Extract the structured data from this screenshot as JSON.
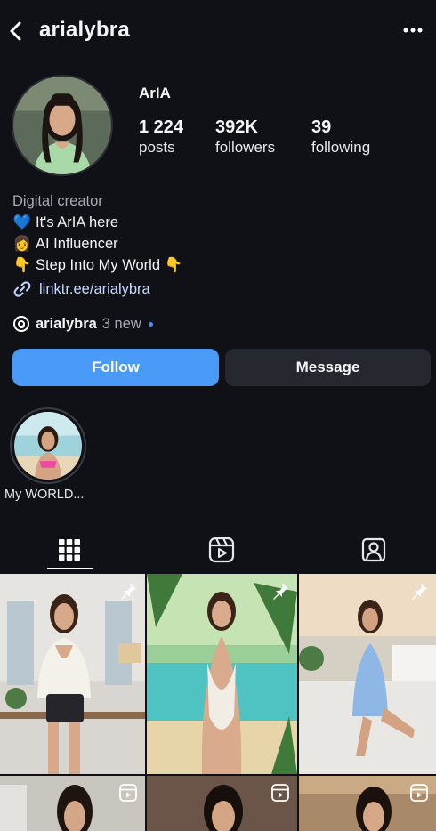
{
  "header": {
    "username": "arialybra",
    "back_icon": "chevron-left-icon",
    "more_icon": "more-horizontal-icon"
  },
  "profile": {
    "display_name": "ArIA",
    "stats": [
      {
        "value": "1 224",
        "label": "posts"
      },
      {
        "value": "392K",
        "label": "followers"
      },
      {
        "value": "39",
        "label": "following"
      }
    ]
  },
  "bio": {
    "category": "Digital creator",
    "lines": [
      {
        "emoji": "💙",
        "text": " It's ArIA here"
      },
      {
        "emoji": "👩",
        "text": "AI Influencer"
      },
      {
        "emoji": "👇",
        "text": "Step Into My World ",
        "trailing_emoji": "👇"
      }
    ],
    "link": "linktr.ee/arialybra"
  },
  "threads": {
    "handle": "arialybra",
    "new_label": "3 new"
  },
  "actions": {
    "follow_label": "Follow",
    "message_label": "Message"
  },
  "highlights": [
    {
      "label": "My WORLD..."
    }
  ],
  "tabs": [
    {
      "name": "grid",
      "icon": "grid-icon",
      "active": true
    },
    {
      "name": "reels",
      "icon": "reels-icon",
      "active": false
    },
    {
      "name": "tagged",
      "icon": "tagged-person-icon",
      "active": false
    }
  ],
  "posts": [
    {
      "badge": "pin-icon"
    },
    {
      "badge": "pin-icon"
    },
    {
      "badge": "pin-icon"
    },
    {
      "badge": "reels-icon"
    },
    {
      "badge": "reels-icon"
    },
    {
      "badge": "reels-icon"
    }
  ],
  "colors": {
    "background": "#0f1116",
    "follow_button": "#4a9af7",
    "message_button": "#25282e",
    "link": "#c9d7ff",
    "new_dot": "#4a8cff"
  }
}
